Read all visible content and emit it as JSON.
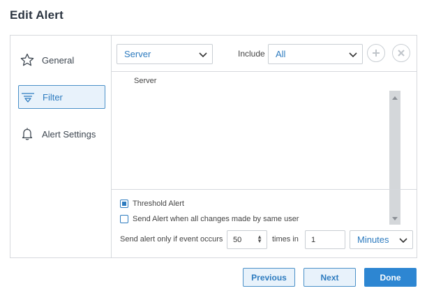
{
  "title": "Edit Alert",
  "nav": {
    "items": [
      {
        "label": "General",
        "icon": "star-icon"
      },
      {
        "label": "Filter",
        "icon": "filter-icon",
        "active": true
      },
      {
        "label": "Alert Settings",
        "icon": "bell-icon"
      }
    ]
  },
  "filter": {
    "type_select": "Server",
    "include_label": "Include",
    "include_select": "All",
    "list_items": [
      "Server"
    ]
  },
  "options": {
    "threshold_label": "Threshold Alert",
    "threshold_checked": true,
    "same_user_label": "Send Alert when all changes made by same user",
    "same_user_checked": false,
    "send_label": "Send alert only if event occurs",
    "occurs_value": "50",
    "times_label": "times in",
    "times_value": "1",
    "unit_select": "Minutes"
  },
  "footer": {
    "previous_label": "Previous",
    "next_label": "Next",
    "done_label": "Done"
  },
  "colors": {
    "accent": "#2d7bbf",
    "active_bg": "#e8f2fb",
    "done_bg": "#2d86d2"
  }
}
